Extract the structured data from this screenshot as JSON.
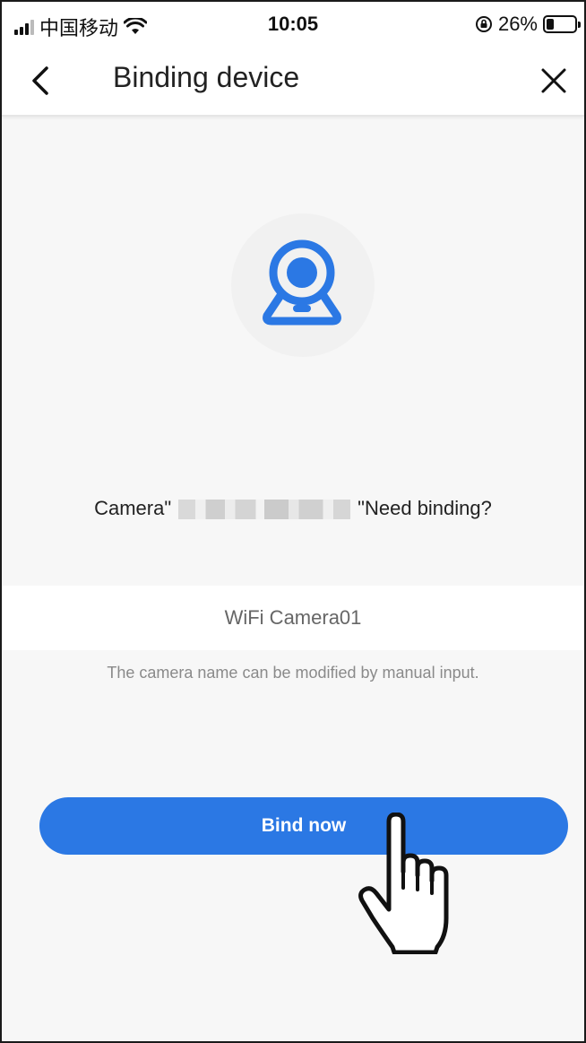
{
  "status_bar": {
    "carrier": "中国移动",
    "time": "10:05",
    "battery_percent": "26%",
    "battery_level": 0.26,
    "icons": [
      "signal-icon",
      "wifi-icon",
      "rotation-lock-icon",
      "battery-icon"
    ]
  },
  "nav": {
    "title": "Binding device",
    "back_icon": "chevron-left-icon",
    "close_icon": "close-icon"
  },
  "device": {
    "icon": "camera-icon",
    "question_prefix": "Camera\"",
    "question_suffix": "\"Need binding?"
  },
  "camera_name": {
    "value": "WiFi Camera01",
    "hint": "The camera name can be modified by manual input."
  },
  "bind_button": {
    "label": "Bind now"
  },
  "overlay": {
    "icon": "pointing-hand-icon"
  },
  "colors": {
    "accent": "#2b78e4",
    "background": "#f7f7f7",
    "hint_text": "#8a8a8a"
  }
}
